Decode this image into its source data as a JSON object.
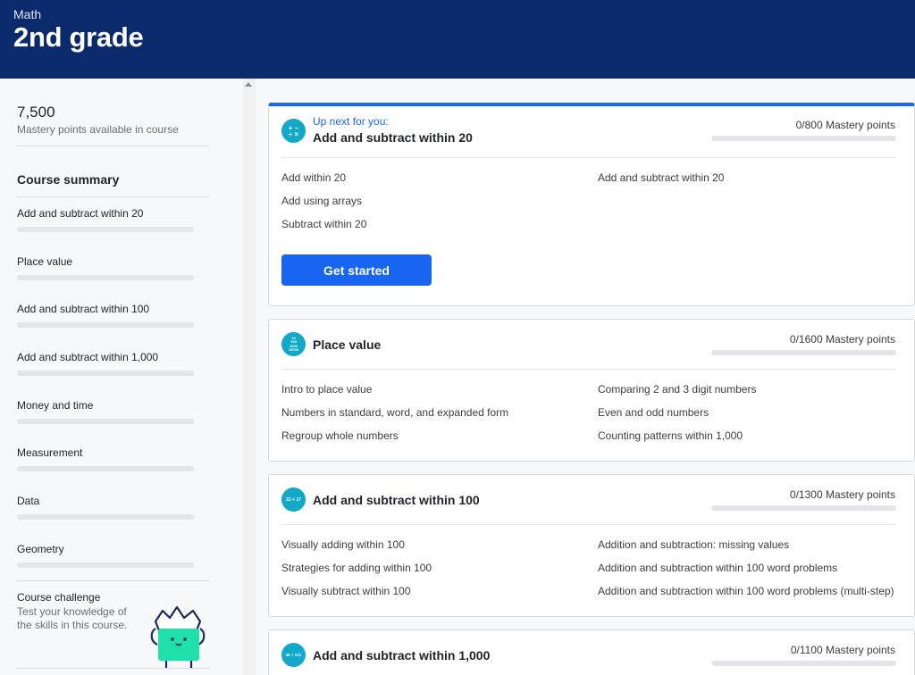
{
  "header": {
    "breadcrumb": "Math",
    "title": "2nd grade"
  },
  "sidebar": {
    "points": "7,500",
    "points_label": "Mastery points available in course",
    "summary_title": "Course summary",
    "items": [
      {
        "label": "Add and subtract within 20",
        "progress": 0
      },
      {
        "label": "Place value",
        "progress": 0
      },
      {
        "label": "Add and subtract within 100",
        "progress": 0
      },
      {
        "label": "Add and subtract within 1,000",
        "progress": 0
      },
      {
        "label": "Money and time",
        "progress": 0
      },
      {
        "label": "Measurement",
        "progress": 0
      },
      {
        "label": "Data",
        "progress": 0
      },
      {
        "label": "Geometry",
        "progress": 0
      }
    ],
    "challenge": {
      "title": "Course challenge",
      "description": "Test your knowledge of the skills in this course."
    }
  },
  "units": [
    {
      "upnext": "Up next for you:",
      "title": "Add and subtract within 20",
      "mastery": "0/800 Mastery points",
      "icon": "operations-icon",
      "skills_left": [
        "Add within 20",
        "Add using arrays",
        "Subtract within 20"
      ],
      "skills_right": [
        "Add and subtract within 20"
      ],
      "button": "Get started"
    },
    {
      "title": "Place value",
      "mastery": "0/1600 Mastery points",
      "icon": "place-value-icon",
      "icon_text": [
        "10",
        "100",
        "1000",
        "10000"
      ],
      "skills_left": [
        "Intro to place value",
        "Numbers in standard, word, and expanded form",
        "Regroup whole numbers"
      ],
      "skills_right": [
        "Comparing 2 and 3 digit numbers",
        "Even and odd numbers",
        "Counting patterns within 1,000"
      ]
    },
    {
      "title": "Add and subtract within 100",
      "mastery": "0/1300 Mastery points",
      "icon": "sum-icon",
      "icon_text": "23 + 17",
      "skills_left": [
        "Visually adding within 100",
        "Strategies for adding within 100",
        "Visually subtract within 100"
      ],
      "skills_right": [
        "Addition and subtraction: missing values",
        "Addition and subtraction within 100 word problems",
        "Addition and subtraction within 100 word problems (multi-step)"
      ]
    },
    {
      "title": "Add and subtract within 1,000",
      "mastery": "0/1100 Mastery points",
      "icon": "sum-icon",
      "icon_text": "46 + 121"
    }
  ],
  "colors": {
    "header_bg": "#0b2a6b",
    "accent": "#1865f2",
    "unit_icon": "#11a8c9",
    "mascot": "#1fe0a9"
  }
}
